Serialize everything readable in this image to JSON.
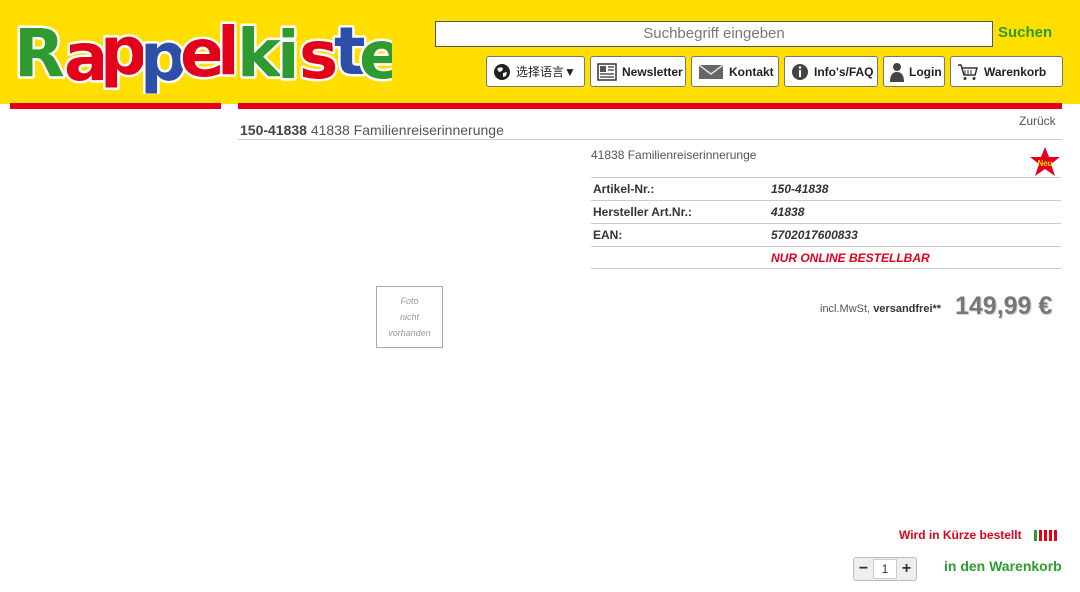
{
  "header": {
    "logo_text": "Rappelkiste",
    "search": {
      "placeholder": "Suchbegriff eingeben",
      "button_label": "Suchen"
    },
    "nav": {
      "language": "选择语言▼",
      "newsletter": "Newsletter",
      "kontakt": "Kontakt",
      "infos": "Info's/FAQ",
      "login": "Login",
      "warenkorb": "Warenkorb"
    },
    "colors": {
      "background": "#ffde00",
      "accent_red": "#e2001a",
      "accent_green": "#2f9a2f"
    }
  },
  "product": {
    "back_link": "Zurück",
    "sku": "150-41838",
    "name": "41838 Familienreiserinnerunge",
    "subtitle": "41838 Familienreiserinnerunge",
    "badge": "Neu",
    "specs": [
      {
        "label": "Artikel-Nr.:",
        "value": "150-41838"
      },
      {
        "label": "Hersteller Art.Nr.:",
        "value": "41838"
      },
      {
        "label": "EAN:",
        "value": "5702017600833"
      },
      {
        "label": "",
        "value": "NUR ONLINE BESTELLBAR"
      }
    ],
    "price_note_prefix": "incl.MwSt, ",
    "price_note_bold": "versandfrei**",
    "price": "149,99 €",
    "no_photo": [
      "Foto",
      "nicht",
      "vorhanden"
    ],
    "availability": "Wird in Kürze bestellt",
    "quantity": "1",
    "qty_minus": "−",
    "qty_plus": "+",
    "add_to_cart": "in den Warenkorb"
  }
}
